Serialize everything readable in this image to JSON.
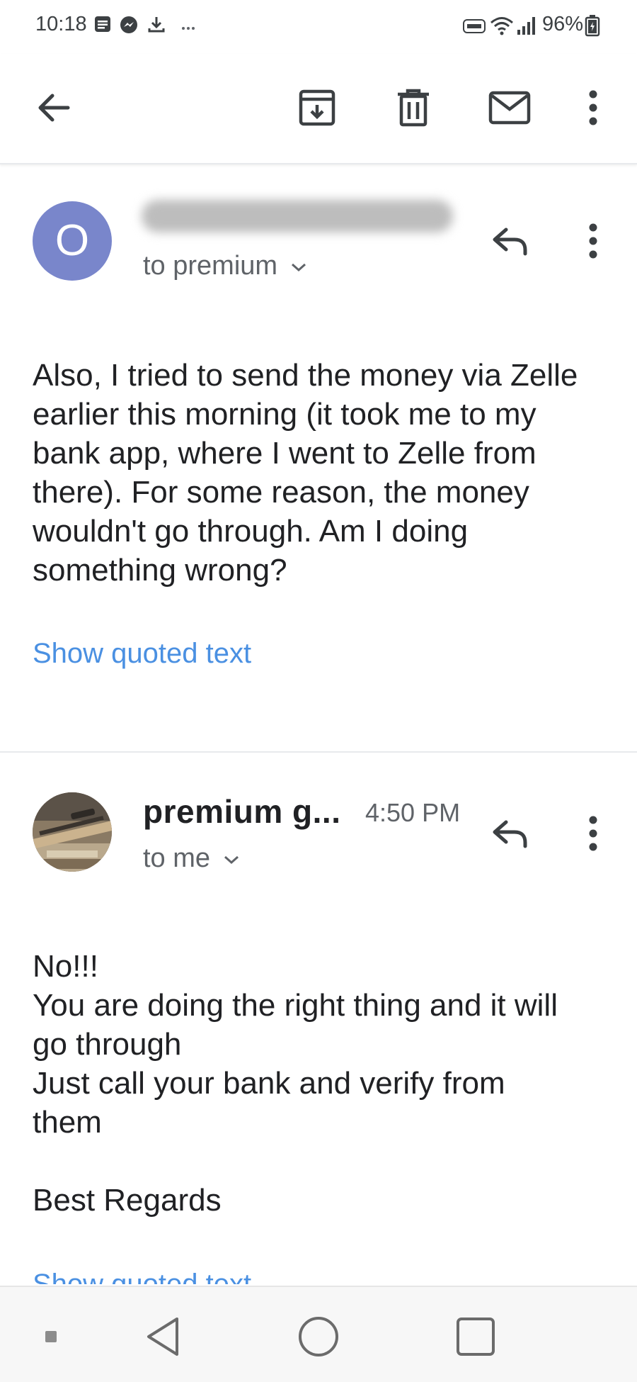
{
  "status_bar": {
    "time": "10:18",
    "notification_icons": [
      "notes-icon",
      "messenger-icon",
      "download-icon",
      "more-notifications-icon"
    ],
    "system_icons": [
      "volte-icon",
      "wifi-icon",
      "signal-icon"
    ],
    "battery_percent": "96%"
  },
  "toolbar": {
    "actions": [
      "back-arrow-icon",
      "archive-icon",
      "delete-icon",
      "mark-unread-icon",
      "more-vert-icon"
    ]
  },
  "messages": [
    {
      "avatar_letter": "O",
      "recipient": "to premium",
      "body": "Also, I tried to send the money via Zelle\nearlier this morning (it took me to my\nbank app, where I went to Zelle from\nthere). For some reason, the money\nwouldn't go through. Am I doing\nsomething wrong?",
      "show_quoted": "Show quoted text"
    },
    {
      "sender": "premium g...",
      "time": "4:50 PM",
      "recipient": "to me",
      "body": "No!!!\nYou are doing the right thing and it will\ngo through\nJust call your bank and verify from\nthem\n\nBest Regards",
      "show_quoted": "Show quoted text"
    }
  ],
  "colors": {
    "avatar": "#7986cb",
    "link": "#4a90e2",
    "text": "#202124",
    "secondary_text": "#5f6368"
  }
}
